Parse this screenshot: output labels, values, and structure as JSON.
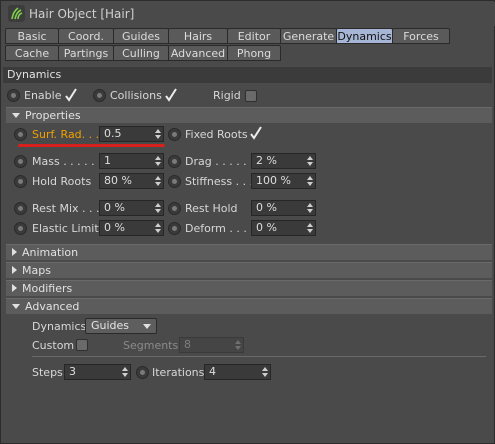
{
  "window": {
    "title": "Hair Object [Hair]",
    "icon": "hair-object-icon"
  },
  "tabs_row1": [
    {
      "label": "Basic",
      "active": false
    },
    {
      "label": "Coord.",
      "active": false
    },
    {
      "label": "Guides",
      "active": false
    },
    {
      "label": "Hairs",
      "active": false
    },
    {
      "label": "Editor",
      "active": false
    },
    {
      "label": "Generate",
      "active": false
    },
    {
      "label": "Dynamics",
      "active": true
    },
    {
      "label": "Forces",
      "active": false
    }
  ],
  "tabs_row2": [
    {
      "label": "Cache"
    },
    {
      "label": "Partings"
    },
    {
      "label": "Culling"
    },
    {
      "label": "Advanced"
    },
    {
      "label": "Phong"
    }
  ],
  "section": {
    "title": "Dynamics"
  },
  "top_options": {
    "enable": {
      "label": "Enable",
      "checked": true
    },
    "collisions": {
      "label": "Collisions",
      "checked": true
    },
    "rigid": {
      "label": "Rigid",
      "checked": false
    }
  },
  "properties": {
    "header": "Properties",
    "surf_rad": {
      "label": "Surf. Rad. . .",
      "value": "0.5",
      "highlight_color": "#f0a000"
    },
    "fixed_roots": {
      "label": "Fixed Roots",
      "checked": true
    },
    "mass": {
      "label": "Mass . . . . . .",
      "value": "1"
    },
    "drag": {
      "label": "Drag . . . . . .",
      "value": "2 %"
    },
    "hold_roots": {
      "label": "Hold Roots",
      "value": "80 %"
    },
    "stiffness": {
      "label": "Stiffness . . .",
      "value": "100 %"
    },
    "rest_mix": {
      "label": "Rest Mix . . .",
      "value": "0 %"
    },
    "rest_hold": {
      "label": "Rest Hold",
      "value": "0 %"
    },
    "elastic_limit": {
      "label": "Elastic Limit",
      "value": "0 %"
    },
    "deform": {
      "label": "Deform . . . .",
      "value": "0 %"
    }
  },
  "groups": {
    "animation": "Animation",
    "maps": "Maps",
    "modifiers": "Modifiers",
    "advanced": "Advanced"
  },
  "advanced": {
    "dynamics_label": "Dynamics",
    "dynamics_value": "Guides",
    "custom_label": "Custom",
    "custom_checked": false,
    "segments_label": "Segments",
    "segments_value": "8",
    "steps_label": "Steps",
    "steps_value": "3",
    "iterations_label": "Iterations",
    "iterations_value": "4"
  },
  "annotation_color": "#d8201c"
}
